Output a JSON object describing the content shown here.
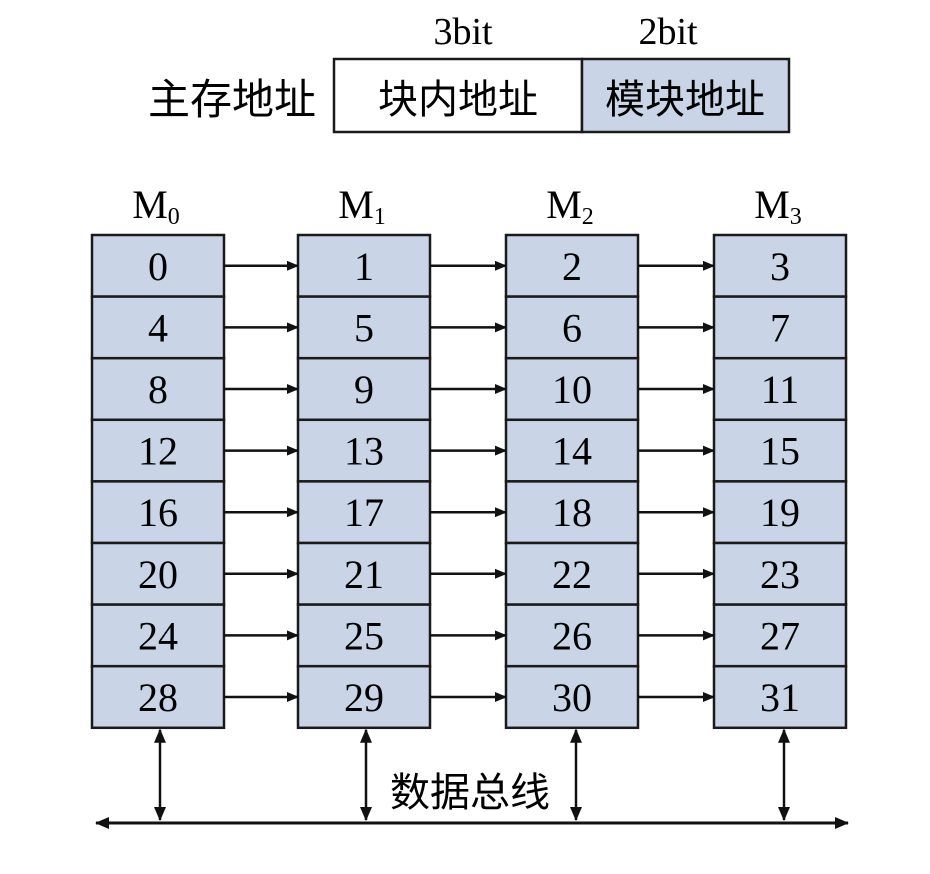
{
  "address_format": {
    "label": "主存地址",
    "fields": [
      {
        "name": "块内地址",
        "width": "3bit",
        "fill": "#ffffff"
      },
      {
        "name": "模块地址",
        "width": "2bit",
        "fill": "#c9d5e6"
      }
    ]
  },
  "modules": [
    {
      "name": "M",
      "subscript": "0",
      "cells": [
        "0",
        "4",
        "8",
        "12",
        "16",
        "20",
        "24",
        "28"
      ]
    },
    {
      "name": "M",
      "subscript": "1",
      "cells": [
        "1",
        "5",
        "9",
        "13",
        "17",
        "21",
        "25",
        "29"
      ]
    },
    {
      "name": "M",
      "subscript": "2",
      "cells": [
        "2",
        "6",
        "10",
        "14",
        "18",
        "22",
        "26",
        "30"
      ]
    },
    {
      "name": "M",
      "subscript": "3",
      "cells": [
        "3",
        "7",
        "11",
        "15",
        "19",
        "23",
        "27",
        "31"
      ]
    }
  ],
  "bus": {
    "label": "数据总线"
  },
  "colors": {
    "cell_fill": "#c9d5e6",
    "stroke": "#1a1a1a"
  }
}
